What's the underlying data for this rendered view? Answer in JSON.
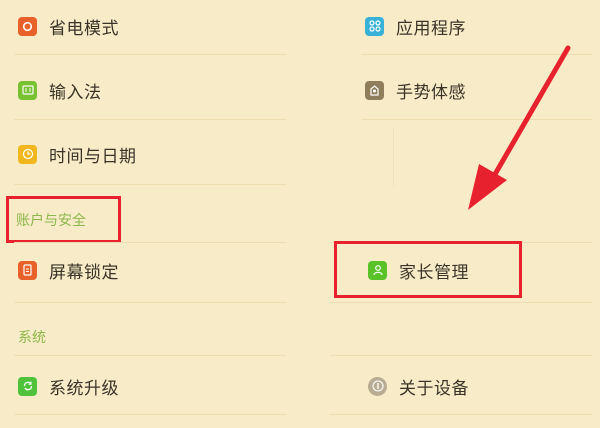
{
  "left_column": [
    {
      "label": "省电模式",
      "icon": "power-saving-icon",
      "color": "#e8602a"
    },
    {
      "label": "输入法",
      "icon": "keyboard-icon",
      "color": "#78c232"
    },
    {
      "label": "时间与日期",
      "icon": "clock-icon",
      "color": "#f0b81e"
    }
  ],
  "right_column": [
    {
      "label": "应用程序",
      "icon": "apps-grid-icon",
      "color": "#37b1d8"
    },
    {
      "label": "手势体感",
      "icon": "gesture-icon",
      "color": "#8f7d5c"
    }
  ],
  "sections": {
    "account_security": {
      "title": "账户与安全",
      "items": [
        {
          "label": "屏幕锁定",
          "icon": "screen-lock-icon",
          "color": "#e8602a"
        },
        {
          "label": "家长管理",
          "icon": "parental-control-icon",
          "color": "#59c229"
        }
      ]
    },
    "system": {
      "title": "系统",
      "items": [
        {
          "label": "系统升级",
          "icon": "system-update-icon",
          "color": "#4ec23a"
        },
        {
          "label": "关于设备",
          "icon": "info-icon",
          "color": "#b8ad93"
        }
      ]
    }
  },
  "annotation_colors": {
    "highlight": "#e8212e",
    "arrow": "#e8212e"
  }
}
